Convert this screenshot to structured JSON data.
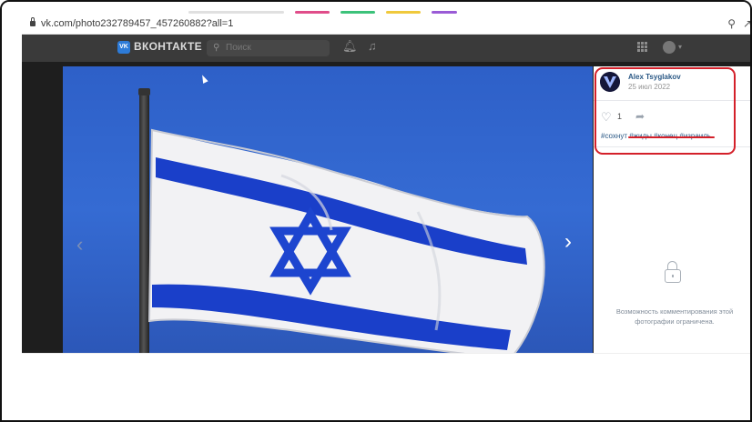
{
  "browser": {
    "url": "vk.com/photo232789457_457260882?all=1"
  },
  "vk_header": {
    "logo_mark": "VK",
    "brand": "ВКОНТАКТЕ",
    "search_placeholder": "Поиск",
    "icons": [
      "bell-icon",
      "music-icon",
      "apps-grid-icon",
      "user-avatar"
    ]
  },
  "photo": {
    "subject": "Israeli flag waving on pole against blue sky",
    "prev_arrow": "‹",
    "next_arrow": "›"
  },
  "side_panel": {
    "author_name": "Alex Tsyglakov",
    "date": "25 июл 2022",
    "like_count": "1",
    "tags": {
      "first": "#сохнут",
      "second": "#жиды",
      "third": "#конец",
      "fourth": "#израиль"
    },
    "comments_restricted": "Возможность комментирования этой фотографии ограничена."
  },
  "colors": {
    "annotation_red": "#d4202a",
    "vk_blue": "#2d7bd8",
    "link_blue": "#2a5885"
  }
}
